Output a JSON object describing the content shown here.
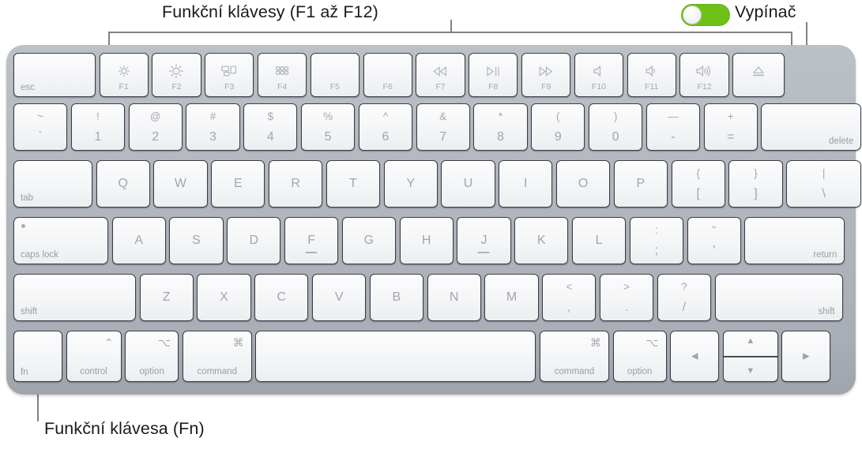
{
  "callouts": {
    "function_keys": "Funkční klávesy (F1 až F12)",
    "power": "Vypínač",
    "fn_key": "Funkční klávesa (Fn)"
  },
  "colors": {
    "toggle_on": "#6fc017",
    "body": "#b4b8c0",
    "key_face": "#f7f8f9",
    "key_text": "#9a9da3",
    "callout_text": "#1a1a1a",
    "leader_line": "#808288"
  },
  "power_toggle": {
    "state": "on",
    "icon": "toggle-switch-icon"
  },
  "keyboard": {
    "rows": {
      "function": [
        {
          "name": "esc",
          "label": "esc",
          "style": "corner"
        },
        {
          "name": "f1",
          "icon": "brightness-down-icon",
          "fn": "F1"
        },
        {
          "name": "f2",
          "icon": "brightness-up-icon",
          "fn": "F2"
        },
        {
          "name": "f3",
          "icon": "mission-control-icon",
          "fn": "F3"
        },
        {
          "name": "f4",
          "icon": "launchpad-icon",
          "fn": "F4"
        },
        {
          "name": "f5",
          "icon": "",
          "fn": "F5"
        },
        {
          "name": "f6",
          "icon": "",
          "fn": "F6"
        },
        {
          "name": "f7",
          "icon": "rewind-icon",
          "fn": "F7"
        },
        {
          "name": "f8",
          "icon": "play-pause-icon",
          "fn": "F8"
        },
        {
          "name": "f9",
          "icon": "fast-forward-icon",
          "fn": "F9"
        },
        {
          "name": "f10",
          "icon": "mute-icon",
          "fn": "F10"
        },
        {
          "name": "f11",
          "icon": "volume-down-icon",
          "fn": "F11"
        },
        {
          "name": "f12",
          "icon": "volume-up-icon",
          "fn": "F12"
        },
        {
          "name": "eject",
          "icon": "eject-icon",
          "fn": ""
        }
      ],
      "numbers": [
        {
          "name": "backtick",
          "upper": "~",
          "lower": "`"
        },
        {
          "name": "key-1",
          "upper": "!",
          "lower": "1"
        },
        {
          "name": "key-2",
          "upper": "@",
          "lower": "2"
        },
        {
          "name": "key-3",
          "upper": "#",
          "lower": "3"
        },
        {
          "name": "key-4",
          "upper": "$",
          "lower": "4"
        },
        {
          "name": "key-5",
          "upper": "%",
          "lower": "5"
        },
        {
          "name": "key-6",
          "upper": "^",
          "lower": "6"
        },
        {
          "name": "key-7",
          "upper": "&",
          "lower": "7"
        },
        {
          "name": "key-8",
          "upper": "*",
          "lower": "8"
        },
        {
          "name": "key-9",
          "upper": "(",
          "lower": "9"
        },
        {
          "name": "key-0",
          "upper": ")",
          "lower": "0"
        },
        {
          "name": "minus",
          "upper": "—",
          "lower": "-"
        },
        {
          "name": "equals",
          "upper": "+",
          "lower": "="
        },
        {
          "name": "delete",
          "label": "delete"
        }
      ],
      "top_letters": [
        {
          "name": "tab",
          "label": "tab"
        },
        {
          "name": "key-q",
          "center": "Q"
        },
        {
          "name": "key-w",
          "center": "W"
        },
        {
          "name": "key-e",
          "center": "E"
        },
        {
          "name": "key-r",
          "center": "R"
        },
        {
          "name": "key-t",
          "center": "T"
        },
        {
          "name": "key-y",
          "center": "Y"
        },
        {
          "name": "key-u",
          "center": "U"
        },
        {
          "name": "key-i",
          "center": "I"
        },
        {
          "name": "key-o",
          "center": "O"
        },
        {
          "name": "key-p",
          "center": "P"
        },
        {
          "name": "bracket-left",
          "upper": "{",
          "lower": "["
        },
        {
          "name": "bracket-right",
          "upper": "}",
          "lower": "]"
        },
        {
          "name": "backslash",
          "upper": "|",
          "lower": "\\"
        }
      ],
      "home_letters": [
        {
          "name": "caps-lock",
          "label": "caps lock"
        },
        {
          "name": "key-a",
          "center": "A"
        },
        {
          "name": "key-s",
          "center": "S"
        },
        {
          "name": "key-d",
          "center": "D"
        },
        {
          "name": "key-f",
          "center": "F",
          "homing": true
        },
        {
          "name": "key-g",
          "center": "G"
        },
        {
          "name": "key-h",
          "center": "H"
        },
        {
          "name": "key-j",
          "center": "J",
          "homing": true
        },
        {
          "name": "key-k",
          "center": "K"
        },
        {
          "name": "key-l",
          "center": "L"
        },
        {
          "name": "semicolon",
          "upper": ":",
          "lower": ";"
        },
        {
          "name": "quote",
          "upper": "\"",
          "lower": "'"
        },
        {
          "name": "return",
          "label": "return"
        }
      ],
      "bottom_letters": [
        {
          "name": "shift-left",
          "label": "shift"
        },
        {
          "name": "key-z",
          "center": "Z"
        },
        {
          "name": "key-x",
          "center": "X"
        },
        {
          "name": "key-c",
          "center": "C"
        },
        {
          "name": "key-v",
          "center": "V"
        },
        {
          "name": "key-b",
          "center": "B"
        },
        {
          "name": "key-n",
          "center": "N"
        },
        {
          "name": "key-m",
          "center": "M"
        },
        {
          "name": "comma",
          "upper": "<",
          "lower": ","
        },
        {
          "name": "period",
          "upper": ">",
          "lower": "."
        },
        {
          "name": "slash",
          "upper": "?",
          "lower": "/"
        },
        {
          "name": "shift-right",
          "label": "shift"
        }
      ],
      "modifiers": [
        {
          "name": "fn",
          "label": "fn",
          "glyph": ""
        },
        {
          "name": "control-left",
          "label": "control",
          "glyph": "⌃"
        },
        {
          "name": "option-left",
          "label": "option",
          "glyph": "⌥"
        },
        {
          "name": "command-left",
          "label": "command",
          "glyph": "⌘"
        },
        {
          "name": "space",
          "label": "",
          "glyph": ""
        },
        {
          "name": "command-right",
          "label": "command",
          "glyph": "⌘"
        },
        {
          "name": "option-right",
          "label": "option",
          "glyph": "⌥"
        },
        {
          "name": "arrow-left",
          "label": "",
          "glyph": "◀"
        },
        {
          "name": "arrow-updown",
          "label": "",
          "glyph": "▲▼"
        },
        {
          "name": "arrow-right",
          "label": "",
          "glyph": "▶"
        }
      ]
    }
  }
}
